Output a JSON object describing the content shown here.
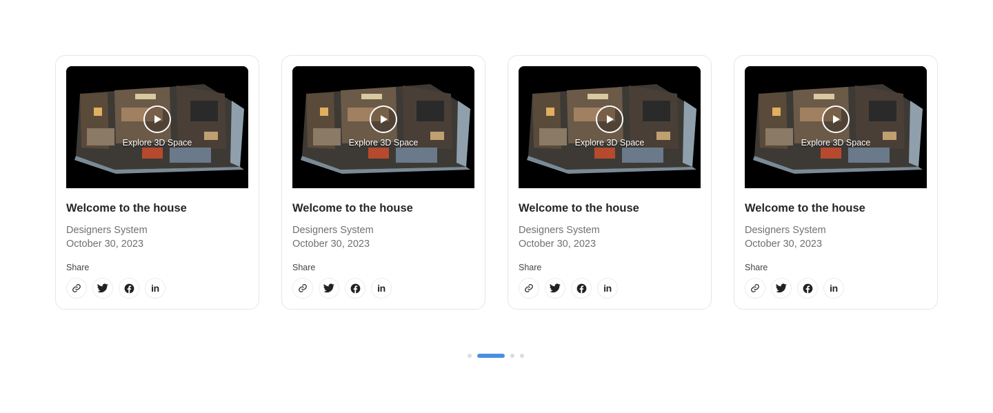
{
  "cards": [
    {
      "overlay_text": "Explore 3D Space",
      "title": "Welcome to the house",
      "author": "Designers System",
      "date": "October 30, 2023",
      "share_label": "Share",
      "share_icons": [
        "link-icon",
        "twitter-icon",
        "facebook-icon",
        "linkedin-icon"
      ],
      "linkedin_text": "in"
    },
    {
      "overlay_text": "Explore 3D Space",
      "title": "Welcome to the house",
      "author": "Designers System",
      "date": "October 30, 2023",
      "share_label": "Share",
      "share_icons": [
        "link-icon",
        "twitter-icon",
        "facebook-icon",
        "linkedin-icon"
      ],
      "linkedin_text": "in"
    },
    {
      "overlay_text": "Explore 3D Space",
      "title": "Welcome to the house",
      "author": "Designers System",
      "date": "October 30, 2023",
      "share_label": "Share",
      "share_icons": [
        "link-icon",
        "twitter-icon",
        "facebook-icon",
        "linkedin-icon"
      ],
      "linkedin_text": "in"
    },
    {
      "overlay_text": "Explore 3D Space",
      "title": "Welcome to the house",
      "author": "Designers System",
      "date": "October 30, 2023",
      "share_label": "Share",
      "share_icons": [
        "link-icon",
        "twitter-icon",
        "facebook-icon",
        "linkedin-icon"
      ],
      "linkedin_text": "in"
    }
  ],
  "pagination": {
    "total_pages": 4,
    "active_index": 1
  },
  "colors": {
    "accent": "#4a90e2",
    "card_border": "#e6e6e6",
    "muted_text": "#707070",
    "inactive_dot": "#dcdcdc"
  }
}
